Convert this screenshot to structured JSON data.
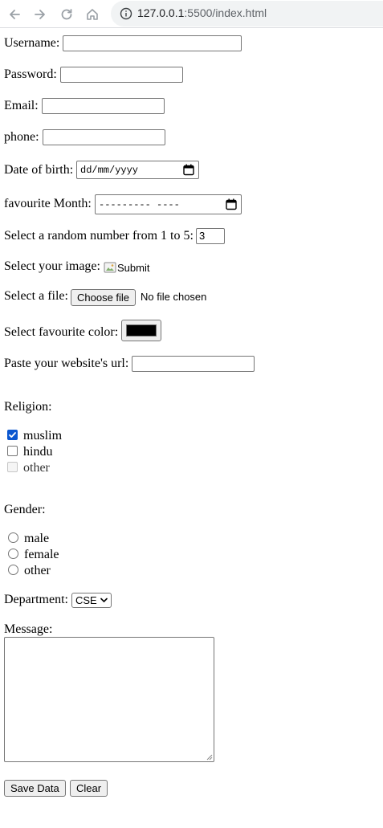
{
  "browser": {
    "url_host": "127.0.0.1",
    "url_rest": ":5500/index.html"
  },
  "form": {
    "username_label": "Username:",
    "password_label": "Password:",
    "email_label": "Email:",
    "phone_label": "phone:",
    "dob_label": "Date of birth:",
    "dob_placeholder": "dd/mm/yyyy",
    "month_label": "favourite Month:",
    "month_placeholder": "--------- ----",
    "number_label": "Select a random number from 1 to 5:",
    "number_value": "3",
    "image_label": "Select your image:",
    "image_alt": "Submit",
    "file_label": "Select a file:",
    "file_button": "Choose file",
    "file_status": "No file chosen",
    "color_label": "Select favourite color:",
    "color_value": "#000000",
    "url_label": "Paste your website's url:",
    "religion_label": "Religion:",
    "religion_options": [
      {
        "label": "muslim",
        "checked": true,
        "disabled": false
      },
      {
        "label": "hindu",
        "checked": false,
        "disabled": false
      },
      {
        "label": "other",
        "checked": false,
        "disabled": true
      }
    ],
    "gender_label": "Gender:",
    "gender_options": [
      {
        "label": "male"
      },
      {
        "label": "female"
      },
      {
        "label": "other"
      }
    ],
    "department_label": "Department:",
    "department_value": "CSE",
    "message_label": "Message:",
    "save_button": "Save Data",
    "clear_button": "Clear"
  }
}
